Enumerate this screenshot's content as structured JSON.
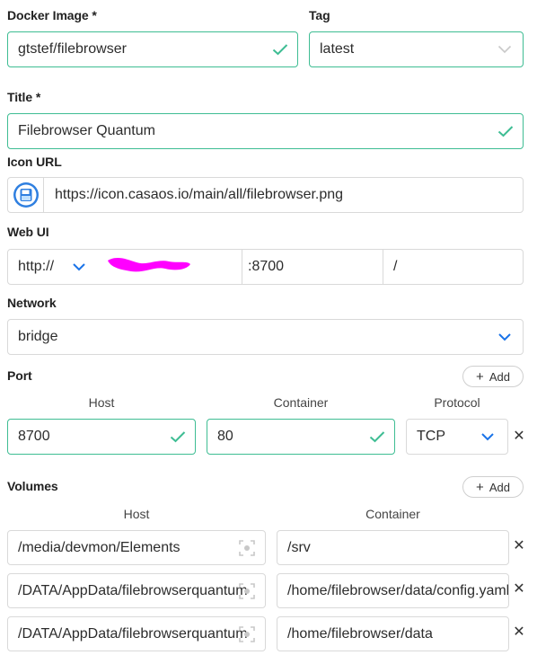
{
  "docker_image": {
    "label": "Docker Image *",
    "value": "gtstef/filebrowser"
  },
  "tag": {
    "label": "Tag",
    "value": "latest"
  },
  "title": {
    "label": "Title *",
    "value": "Filebrowser Quantum"
  },
  "icon_url": {
    "label": "Icon URL",
    "value": "https://icon.casaos.io/main/all/filebrowser.png"
  },
  "web_ui": {
    "label": "Web UI",
    "scheme": "http://",
    "port": ":8700",
    "path": "/"
  },
  "network": {
    "label": "Network",
    "value": "bridge"
  },
  "port": {
    "label": "Port",
    "add_label": "Add",
    "headers": {
      "host": "Host",
      "container": "Container",
      "protocol": "Protocol"
    },
    "rows": [
      {
        "host": "8700",
        "container": "80",
        "protocol": "TCP"
      }
    ]
  },
  "volumes": {
    "label": "Volumes",
    "add_label": "Add",
    "headers": {
      "host": "Host",
      "container": "Container"
    },
    "rows": [
      {
        "host": "/media/devmon/Elements",
        "container": "/srv"
      },
      {
        "host": "/DATA/AppData/filebrowserquantum",
        "container": "/home/filebrowser/data/config.yaml"
      },
      {
        "host": "/DATA/AppData/filebrowserquantum",
        "container": "/home/filebrowser/data"
      }
    ]
  },
  "colors": {
    "valid_border": "#3ebd93",
    "accent": "#1a73e8",
    "redaction": "#ff00ff"
  }
}
